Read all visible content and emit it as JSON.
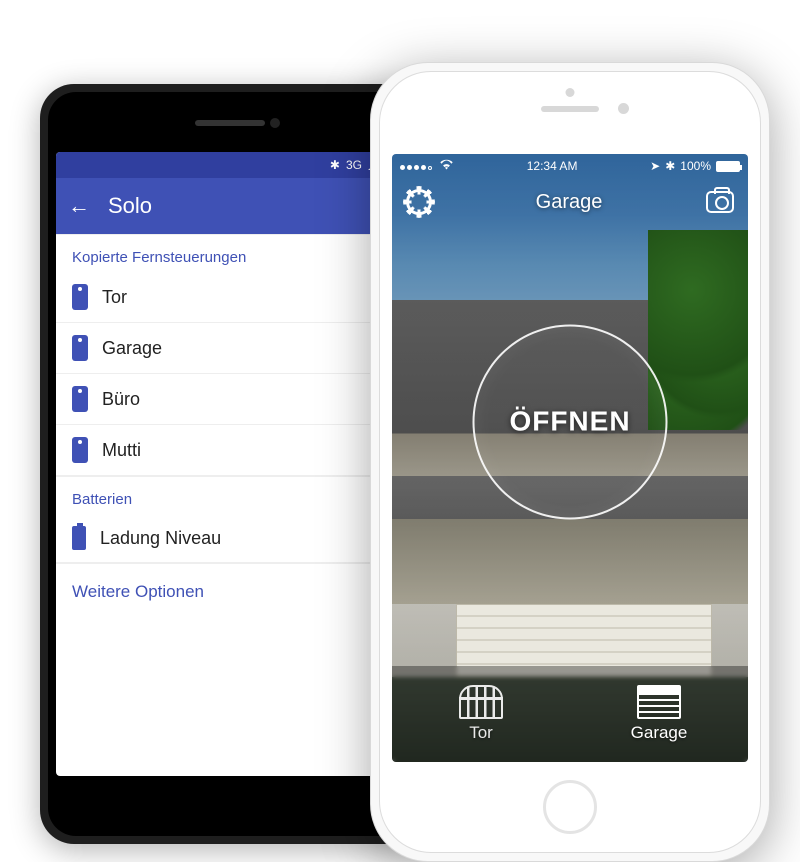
{
  "android": {
    "statusbar": {
      "network_label": "3G"
    },
    "appbar": {
      "title": "Solo"
    },
    "sections": {
      "remotes": {
        "label": "Kopierte Fernsteuerungen",
        "items": [
          "Tor",
          "Garage",
          "Büro",
          "Mutti"
        ]
      },
      "batteries": {
        "label": "Batterien",
        "items": [
          "Ladung Niveau"
        ]
      }
    },
    "more_options": "Weitere Optionen"
  },
  "iphone": {
    "statusbar": {
      "time": "12:34 AM",
      "battery": "100%"
    },
    "navbar": {
      "title": "Garage"
    },
    "primary_action": "ÖFFNEN",
    "tabs": [
      {
        "label": "Tor",
        "kind": "gate"
      },
      {
        "label": "Garage",
        "kind": "garage"
      }
    ]
  }
}
